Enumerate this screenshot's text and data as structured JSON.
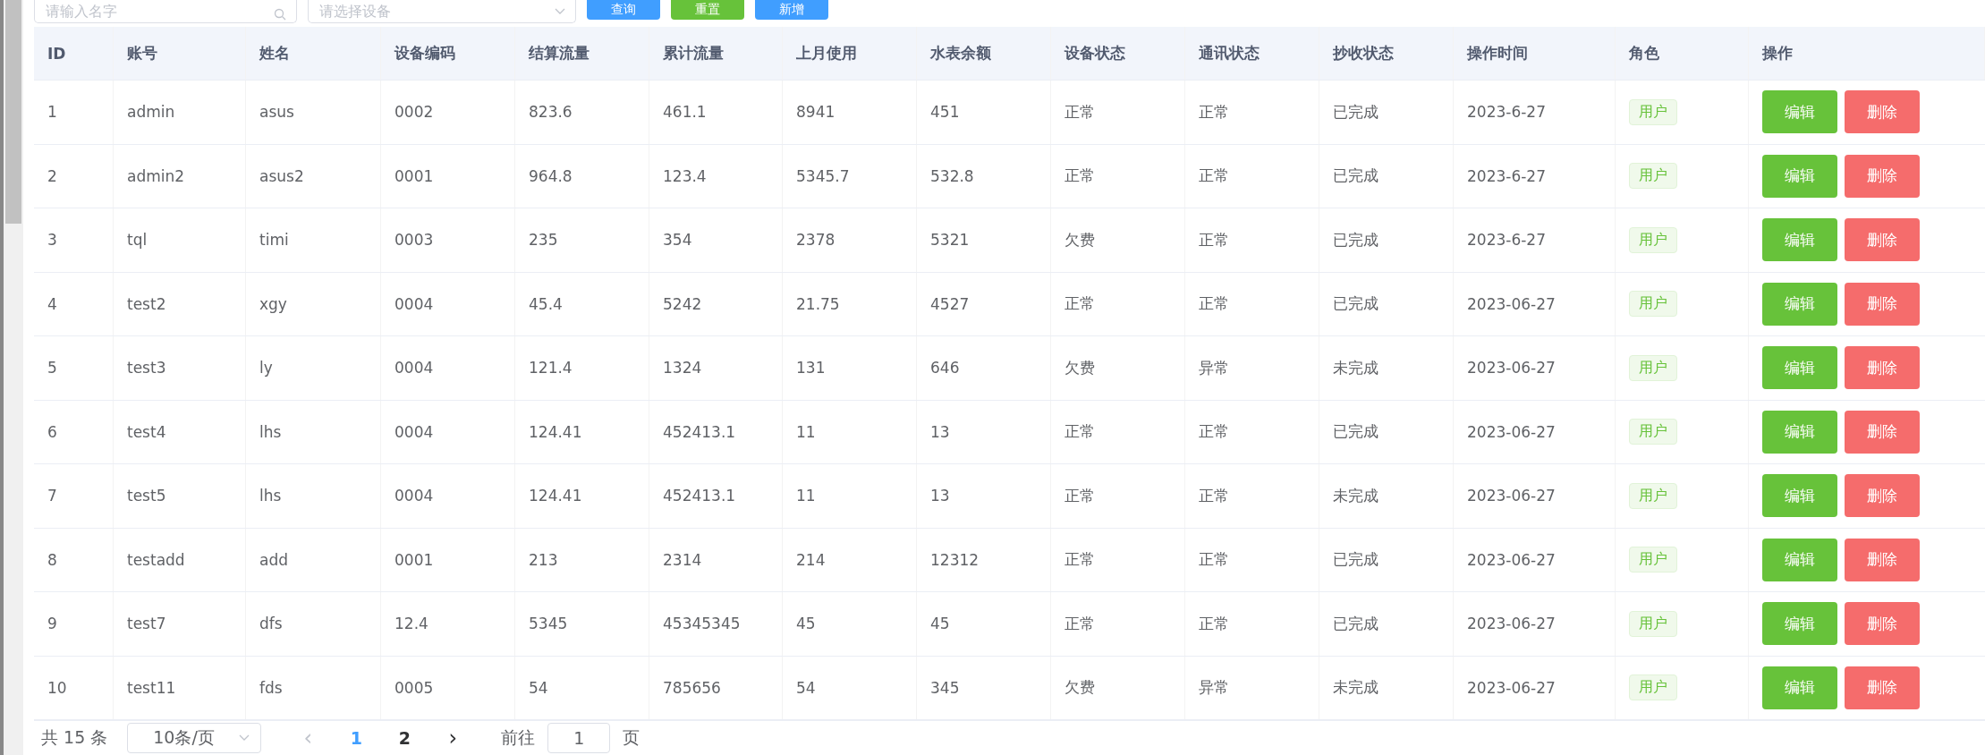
{
  "toolbar": {
    "name_field": {
      "placeholder": "请输入名字"
    },
    "device_select": {
      "placeholder": "请选择设备"
    },
    "buttons": [
      {
        "label": "查询",
        "kind": "primary"
      },
      {
        "label": "重置",
        "kind": "success"
      },
      {
        "label": "新增",
        "kind": "primary"
      }
    ]
  },
  "table": {
    "columns": [
      "ID",
      "账号",
      "姓名",
      "设备编码",
      "结算流量",
      "累计流量",
      "上月使用",
      "水表余额",
      "设备状态",
      "通讯状态",
      "抄收状态",
      "操作时间",
      "角色",
      "操作"
    ],
    "rows": [
      {
        "cells": [
          "1",
          "admin",
          "asus",
          "0002",
          "823.6",
          "461.1",
          "8941",
          "451",
          "正常",
          "正常",
          "已完成",
          "2023-6-27"
        ],
        "role": "用户",
        "actions": [
          "编辑",
          "删除"
        ]
      },
      {
        "cells": [
          "2",
          "admin2",
          "asus2",
          "0001",
          "964.8",
          "123.4",
          "5345.7",
          "532.8",
          "正常",
          "正常",
          "已完成",
          "2023-6-27"
        ],
        "role": "用户",
        "actions": [
          "编辑",
          "删除"
        ]
      },
      {
        "cells": [
          "3",
          "tql",
          "timi",
          "0003",
          "235",
          "354",
          "2378",
          "5321",
          "欠费",
          "正常",
          "已完成",
          "2023-6-27"
        ],
        "role": "用户",
        "actions": [
          "编辑",
          "删除"
        ]
      },
      {
        "cells": [
          "4",
          "test2",
          "xgy",
          "0004",
          "45.4",
          "5242",
          "21.75",
          "4527",
          "正常",
          "正常",
          "已完成",
          "2023-06-27"
        ],
        "role": "用户",
        "actions": [
          "编辑",
          "删除"
        ]
      },
      {
        "cells": [
          "5",
          "test3",
          "ly",
          "0004",
          "121.4",
          "1324",
          "131",
          "646",
          "欠费",
          "异常",
          "未完成",
          "2023-06-27"
        ],
        "role": "用户",
        "actions": [
          "编辑",
          "删除"
        ]
      },
      {
        "cells": [
          "6",
          "test4",
          "lhs",
          "0004",
          "124.41",
          "452413.1",
          "11",
          "13",
          "正常",
          "正常",
          "已完成",
          "2023-06-27"
        ],
        "role": "用户",
        "actions": [
          "编辑",
          "删除"
        ]
      },
      {
        "cells": [
          "7",
          "test5",
          "lhs",
          "0004",
          "124.41",
          "452413.1",
          "11",
          "13",
          "正常",
          "正常",
          "未完成",
          "2023-06-27"
        ],
        "role": "用户",
        "actions": [
          "编辑",
          "删除"
        ]
      },
      {
        "cells": [
          "8",
          "testadd",
          "add",
          "0001",
          "213",
          "2314",
          "214",
          "12312",
          "正常",
          "正常",
          "已完成",
          "2023-06-27"
        ],
        "role": "用户",
        "actions": [
          "编辑",
          "删除"
        ]
      },
      {
        "cells": [
          "9",
          "test7",
          "dfs",
          "12.4",
          "5345",
          "45345345",
          "45",
          "45",
          "正常",
          "正常",
          "已完成",
          "2023-06-27"
        ],
        "role": "用户",
        "actions": [
          "编辑",
          "删除"
        ]
      },
      {
        "cells": [
          "10",
          "test11",
          "fds",
          "0005",
          "54",
          "785656",
          "54",
          "345",
          "欠费",
          "异常",
          "未完成",
          "2023-06-27"
        ],
        "role": "用户",
        "actions": [
          "编辑",
          "删除"
        ]
      }
    ]
  },
  "pagination": {
    "total": "共 15 条",
    "page_size": "10条/页",
    "prev": "‹",
    "pages": [
      {
        "label": "1",
        "selected": true
      },
      {
        "label": "2",
        "selected": false
      }
    ],
    "next": "›",
    "goto_label": "前往",
    "goto_value": "1",
    "goto_suffix": "页"
  }
}
